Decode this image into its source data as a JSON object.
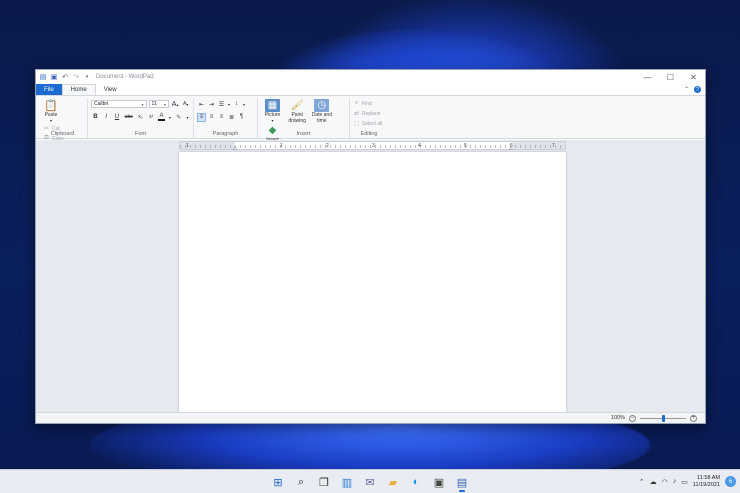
{
  "window": {
    "title": "Document - WordPad",
    "quick_access": [
      "save-icon",
      "undo-icon",
      "redo-icon",
      "customize-icon"
    ],
    "controls": {
      "minimize": "—",
      "maximize": "☐",
      "close": "✕"
    }
  },
  "tabs": [
    {
      "label": "File"
    },
    {
      "label": "Home"
    },
    {
      "label": "View"
    }
  ],
  "ribbon": {
    "clipboard": {
      "label": "Clipboard",
      "paste": "Paste",
      "cut": "Cut",
      "copy": "Copy"
    },
    "font": {
      "label": "Font",
      "family": "Calibri",
      "size": "11",
      "bold": "B",
      "italic": "I",
      "underline": "U",
      "strike": "abc",
      "subscript": "x₂",
      "superscript": "x²",
      "color": "A",
      "grow": "A",
      "shrink": "A"
    },
    "paragraph": {
      "label": "Paragraph"
    },
    "insert": {
      "label": "Insert",
      "picture": "Picture",
      "paint": "Paint drawing",
      "datetime": "Date and time",
      "object": "Insert object"
    },
    "editing": {
      "label": "Editing",
      "find": "Find",
      "replace": "Replace",
      "select_all": "Select all"
    }
  },
  "ruler": {
    "numbers": [
      "1",
      "1",
      "2",
      "3",
      "4",
      "5",
      "6",
      "7"
    ]
  },
  "status": {
    "zoom": "100%",
    "zoom_fraction": 0.5
  },
  "taskbar": {
    "clock_time": "11:58 AM",
    "clock_date": "11/19/2021",
    "notifications": "6"
  }
}
